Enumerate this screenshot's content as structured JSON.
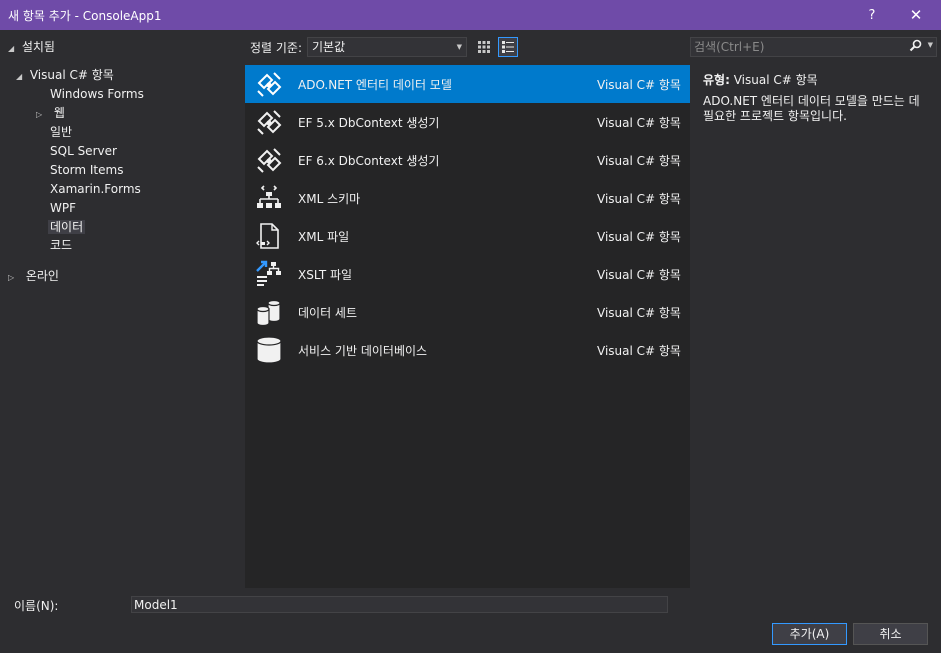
{
  "window": {
    "title": "새 항목 추가 - ConsoleApp1",
    "help": "?",
    "close": "✕"
  },
  "tree": {
    "installed": "설치됨",
    "visual_csharp": "Visual C# 항목",
    "children": [
      "Windows Forms",
      "웹",
      "일반",
      "SQL Server",
      "Storm Items",
      "Xamarin.Forms",
      "WPF",
      "데이터",
      "코드"
    ],
    "online": "온라인"
  },
  "toolbar": {
    "sort_label": "정렬 기준:",
    "sort_value": "기본값"
  },
  "search": {
    "placeholder": "검색(Ctrl+E)"
  },
  "items": [
    {
      "name": "ADO.NET 엔터티 데이터 모델",
      "category": "Visual C# 항목",
      "icon": "entity-model-icon"
    },
    {
      "name": "EF 5.x DbContext 생성기",
      "category": "Visual C# 항목",
      "icon": "entity-model-icon"
    },
    {
      "name": "EF 6.x DbContext 생성기",
      "category": "Visual C# 항목",
      "icon": "entity-model-icon"
    },
    {
      "name": "XML 스키마",
      "category": "Visual C# 항목",
      "icon": "xml-schema-icon"
    },
    {
      "name": "XML 파일",
      "category": "Visual C# 항목",
      "icon": "xml-file-icon"
    },
    {
      "name": "XSLT 파일",
      "category": "Visual C# 항목",
      "icon": "xslt-file-icon"
    },
    {
      "name": "데이터 세트",
      "category": "Visual C# 항목",
      "icon": "dataset-icon"
    },
    {
      "name": "서비스 기반 데이터베이스",
      "category": "Visual C# 항목",
      "icon": "database-icon"
    }
  ],
  "details": {
    "type_key": "유형:",
    "type_value": "Visual C# 항목",
    "description": "ADO.NET 엔터티 데이터 모델을 만드는 데 필요한 프로젝트 항목입니다."
  },
  "bottom": {
    "name_label": "이름(N):",
    "name_value": "Model1",
    "add_button": "추가(A)",
    "cancel_button": "취소"
  },
  "colors": {
    "titlebar": "#6f4ba8",
    "background": "#2d2d30",
    "list_bg": "#252526",
    "selection": "#007acc"
  }
}
